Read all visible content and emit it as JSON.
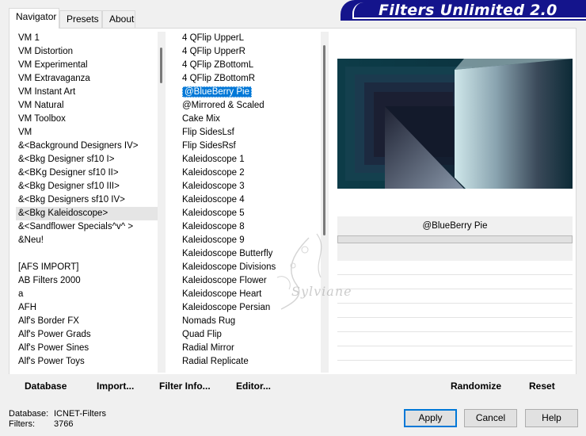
{
  "tabs": [
    {
      "label": "Navigator"
    },
    {
      "label": "Presets"
    },
    {
      "label": "About"
    }
  ],
  "banner": {
    "title": "Filters Unlimited 2.0"
  },
  "categories": [
    "VM 1",
    "VM Distortion",
    "VM Experimental",
    "VM Extravaganza",
    "VM Instant Art",
    "VM Natural",
    "VM Toolbox",
    "VM",
    "&<Background Designers IV>",
    "&<Bkg Designer sf10 I>",
    "&<BKg Designer sf10 II>",
    "&<Bkg Designer sf10 III>",
    "&<Bkg Designers sf10 IV>",
    "&<Bkg Kaleidoscope>",
    "&<Sandflower Specials^v^ >",
    "&Neu!",
    "",
    "[AFS IMPORT]",
    "AB Filters 2000",
    "a",
    "AFH",
    "Alf's Border FX",
    "Alf's Power Grads",
    "Alf's Power Sines",
    "Alf's Power Toys"
  ],
  "categories_selected_index": 13,
  "filters": [
    "4 QFlip UpperL",
    "4 QFlip UpperR",
    "4 QFlip ZBottomL",
    "4 QFlip ZBottomR",
    "@BlueBerry Pie",
    "@Mirrored & Scaled",
    "Cake Mix",
    "Flip SidesLsf",
    "Flip SidesRsf",
    "Kaleidoscope 1",
    "Kaleidoscope 2",
    "Kaleidoscope 3",
    "Kaleidoscope 4",
    "Kaleidoscope 5",
    "Kaleidoscope 8",
    "Kaleidoscope 9",
    "Kaleidoscope Butterfly",
    "Kaleidoscope Divisions",
    "Kaleidoscope Flower",
    "Kaleidoscope Heart",
    "Kaleidoscope Persian",
    "Nomads Rug",
    "Quad Flip",
    "Radial Mirror",
    "Radial Replicate"
  ],
  "filters_selected_index": 4,
  "preview": {
    "filter_name": "@BlueBerry Pie"
  },
  "toolbar": {
    "database": "Database",
    "import": "Import...",
    "filter_info": "Filter Info...",
    "editor": "Editor...",
    "randomize": "Randomize",
    "reset": "Reset"
  },
  "status": {
    "database_label": "Database:",
    "database_value": "ICNET-Filters",
    "filters_label": "Filters:",
    "filters_value": "3766"
  },
  "buttons": {
    "apply": "Apply",
    "cancel": "Cancel",
    "help": "Help"
  },
  "watermark": "Sylviane",
  "colors": {
    "banner": "#14148c",
    "selection": "#0078d7",
    "preview_dark": "#0e3a45"
  }
}
